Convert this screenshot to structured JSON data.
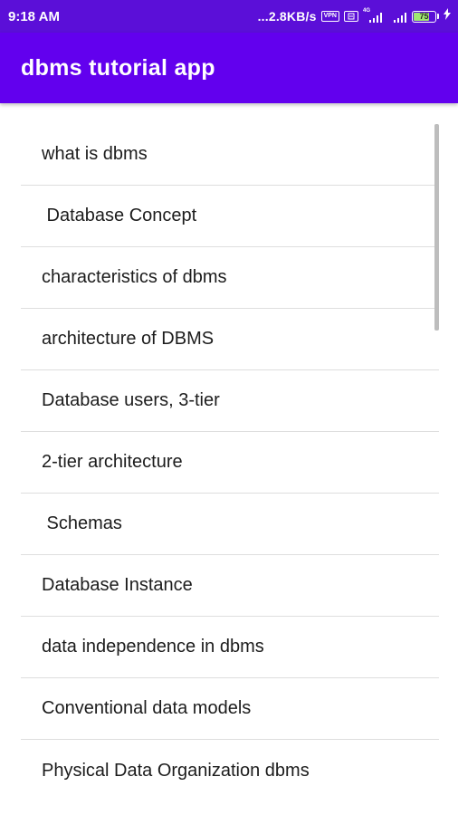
{
  "status_bar": {
    "time": "9:18 AM",
    "network_speed": "...2.8KB/s",
    "vpn_label": "VPN",
    "network_type": "4G",
    "battery_level": "75",
    "battery_fraction": 0.75,
    "icons": [
      "vpn-icon",
      "sim-icon",
      "signal-icon",
      "signal-icon",
      "battery-icon",
      "charging-icon"
    ]
  },
  "app_bar": {
    "title": "dbms tutorial app",
    "color": "#6200ee"
  },
  "topics": [
    {
      "label": "what is dbms"
    },
    {
      "label": " Database Concept"
    },
    {
      "label": "characteristics of dbms"
    },
    {
      "label": "architecture of DBMS"
    },
    {
      "label": "Database users, 3-tier"
    },
    {
      "label": "2-tier architecture"
    },
    {
      "label": " Schemas"
    },
    {
      "label": "Database Instance"
    },
    {
      "label": "data independence in dbms"
    },
    {
      "label": "Conventional data models"
    },
    {
      "label": "Physical Data Organization dbms"
    }
  ]
}
